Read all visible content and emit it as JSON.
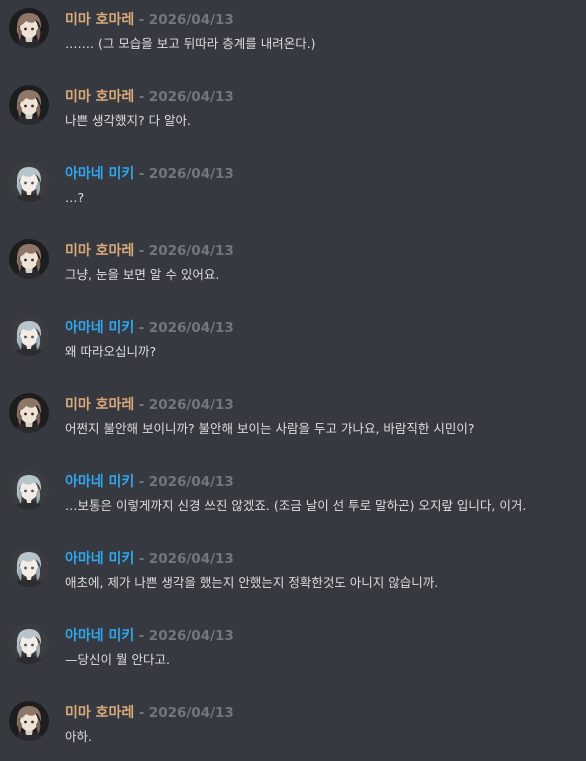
{
  "users": {
    "hyomi": {
      "name": "미마 호마레",
      "color": "#d9a979",
      "avatar_icon": "brown-haired-character-avatar"
    },
    "miki": {
      "name": "아마네 미키",
      "color": "#2fa6ee",
      "avatar_icon": "silver-haired-character-avatar"
    }
  },
  "messages": [
    {
      "user": "hyomi",
      "name": "미마 호마레",
      "sep": "-",
      "date": "2026/04/13",
      "text": "……. (그 모습을 보고 뒤따라 층계를 내려온다.)"
    },
    {
      "user": "hyomi",
      "name": "미마 호마레",
      "sep": "-",
      "date": "2026/04/13",
      "text": "나쁜 생각했지? 다 알아."
    },
    {
      "user": "miki",
      "name": "아마네 미키",
      "sep": "-",
      "date": "2026/04/13",
      "text": "…?"
    },
    {
      "user": "hyomi",
      "name": "미마 호마레",
      "sep": "-",
      "date": "2026/04/13",
      "text": "그냥, 눈을 보면 알 수 있어요."
    },
    {
      "user": "miki",
      "name": "아마네 미키",
      "sep": "-",
      "date": "2026/04/13",
      "text": "왜 따라오십니까?"
    },
    {
      "user": "hyomi",
      "name": "미마 호마레",
      "sep": "-",
      "date": "2026/04/13",
      "text": "어쩐지 불안해 보이니까? 불안해 보이는 사람을 두고 가나요, 바람직한 시민이?"
    },
    {
      "user": "miki",
      "name": "아마네 미키",
      "sep": "-",
      "date": "2026/04/13",
      "text": "…보통은 이렇게까지 신경 쓰진 않겠죠. (조금 날이 선 투로 말하곤) 오지랖 입니다, 이거."
    },
    {
      "user": "miki",
      "name": "아마네 미키",
      "sep": "-",
      "date": "2026/04/13",
      "text": "애초에, 제가 나쁜 생각을 했는지 안했는지 정확한것도 아니지 않습니까."
    },
    {
      "user": "miki",
      "name": "아마네 미키",
      "sep": "-",
      "date": "2026/04/13",
      "text": "—당신이 뭘 안다고."
    },
    {
      "user": "hyomi",
      "name": "미마 호마레",
      "sep": "-",
      "date": "2026/04/13",
      "text": "아하."
    }
  ]
}
